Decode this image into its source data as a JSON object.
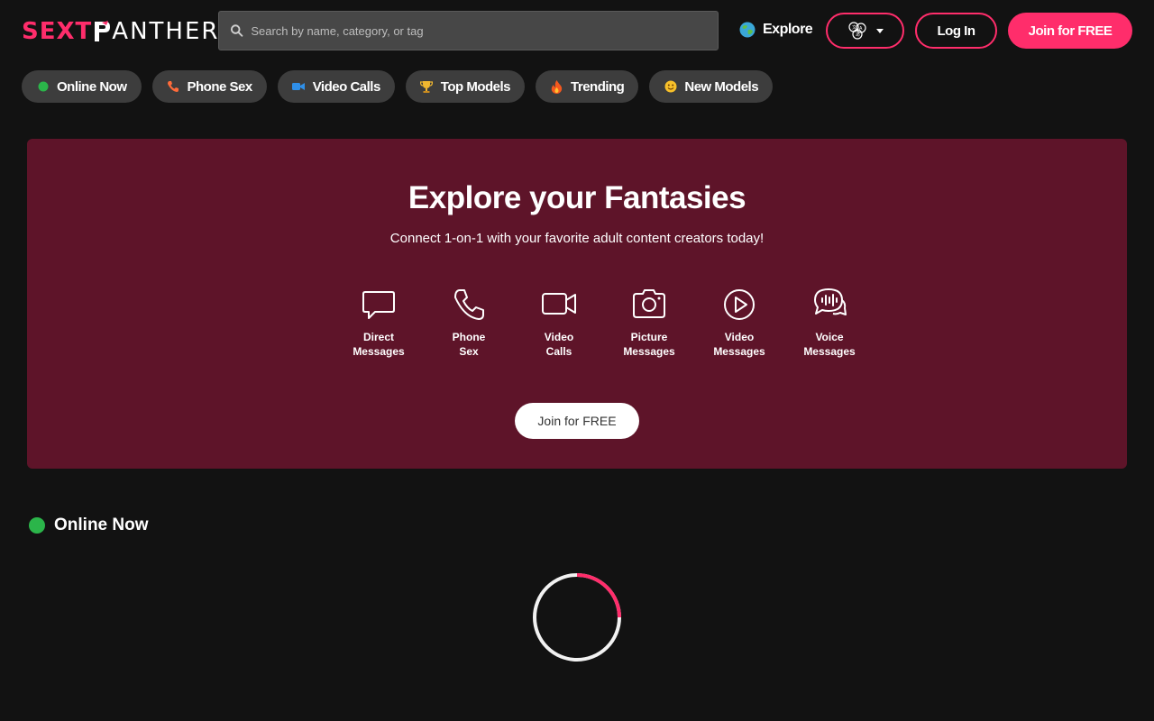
{
  "logo": {
    "part1": "SEXT",
    "part2": "ANTHER"
  },
  "search": {
    "placeholder": "Search by name, category, or tag"
  },
  "header": {
    "explore_label": "Explore",
    "login_label": "Log In",
    "join_label": "Join for FREE"
  },
  "categories": [
    {
      "label": "Online Now",
      "icon": "green-dot-icon"
    },
    {
      "label": "Phone Sex",
      "icon": "phone-icon"
    },
    {
      "label": "Video Calls",
      "icon": "video-camera-icon"
    },
    {
      "label": "Top Models",
      "icon": "trophy-icon"
    },
    {
      "label": "Trending",
      "icon": "fire-icon"
    },
    {
      "label": "New Models",
      "icon": "smiley-icon"
    }
  ],
  "hero": {
    "title": "Explore your Fantasies",
    "subtitle": "Connect 1-on-1 with your favorite adult content creators today!",
    "features": [
      {
        "line1": "Direct",
        "line2": "Messages",
        "icon": "chat-bubble-icon"
      },
      {
        "line1": "Phone",
        "line2": "Sex",
        "icon": "phone-icon"
      },
      {
        "line1": "Video",
        "line2": "Calls",
        "icon": "video-camera-icon"
      },
      {
        "line1": "Picture",
        "line2": "Messages",
        "icon": "camera-icon"
      },
      {
        "line1": "Video",
        "line2": "Messages",
        "icon": "play-circle-icon"
      },
      {
        "line1": "Voice",
        "line2": "Messages",
        "icon": "voice-chat-icon"
      }
    ],
    "join_label": "Join for FREE"
  },
  "online_section": {
    "title": "Online Now"
  },
  "colors": {
    "accent": "#ff2d6b",
    "background": "#121212",
    "hero_background": "#5e1429",
    "pill_background": "#3d3d3d",
    "online_green": "#2bb54a"
  }
}
